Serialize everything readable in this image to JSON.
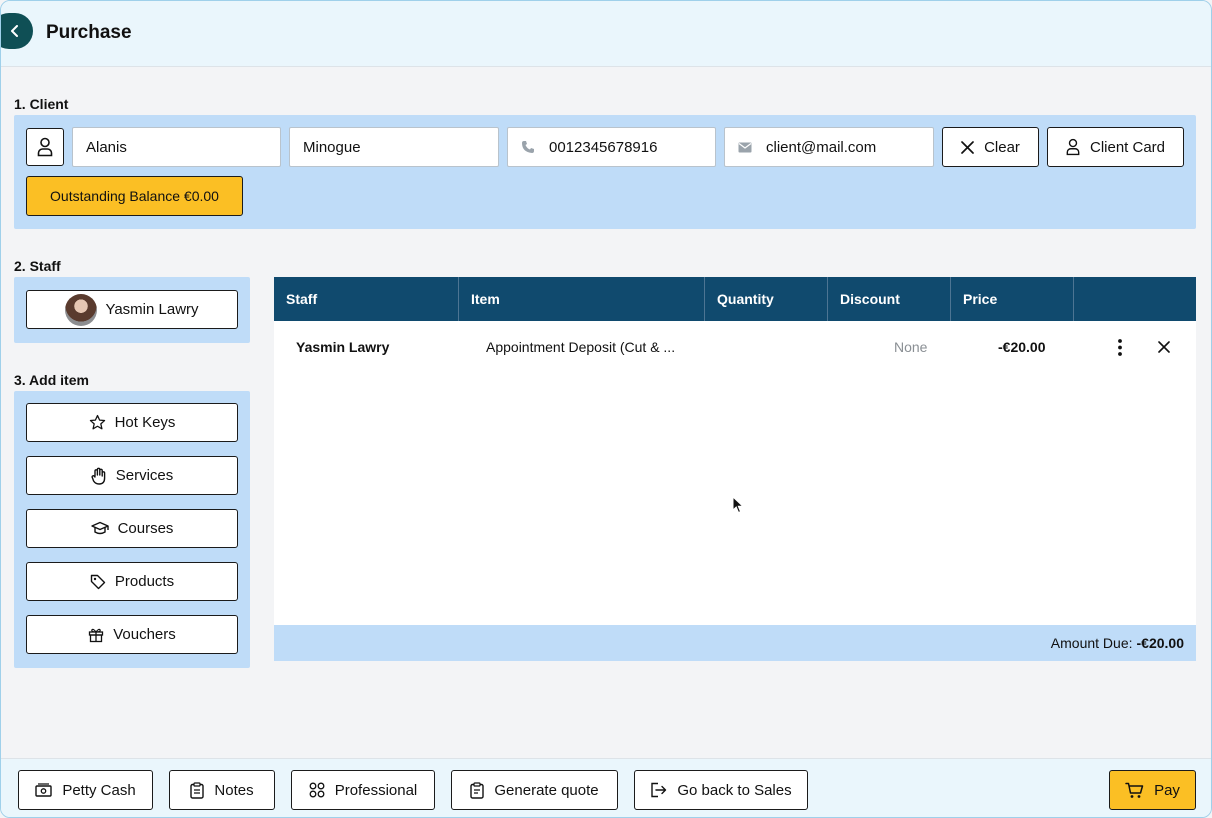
{
  "header": {
    "title": "Purchase"
  },
  "client": {
    "section_label": "1. Client",
    "first_name": "Alanis",
    "last_name": "Minogue",
    "phone": "0012345678916",
    "email": "client@mail.com",
    "clear_label": "Clear",
    "client_card_label": "Client Card",
    "balance_label": "Outstanding Balance €0.00"
  },
  "staff": {
    "section_label": "2. Staff",
    "selected_name": "Yasmin Lawry"
  },
  "add_item": {
    "section_label": "3. Add item",
    "buttons": [
      {
        "label": "Hot Keys",
        "icon": "star-icon"
      },
      {
        "label": "Services",
        "icon": "hand-icon"
      },
      {
        "label": "Courses",
        "icon": "graduation-cap-icon"
      },
      {
        "label": "Products",
        "icon": "tag-icon"
      },
      {
        "label": "Vouchers",
        "icon": "gift-icon"
      }
    ]
  },
  "table": {
    "columns": [
      "Staff",
      "Item",
      "Quantity",
      "Discount",
      "Price",
      ""
    ],
    "rows": [
      {
        "staff": "Yasmin Lawry",
        "item": "Appointment Deposit (Cut & ...",
        "quantity": "",
        "discount": "None",
        "price": "-€20.00"
      }
    ],
    "amount_due_label": "Amount Due:",
    "amount_due_value": "-€20.00"
  },
  "footer": {
    "petty_cash": "Petty Cash",
    "notes": "Notes",
    "professional": "Professional",
    "generate_quote": "Generate quote",
    "go_back": "Go back to Sales",
    "pay": "Pay"
  },
  "colors": {
    "header_bg": "#eaf6fc",
    "panel_bg": "#bfdcf8",
    "table_header": "#104a6e",
    "accent_yellow": "#fbbf24",
    "back_button": "#0f4f55"
  }
}
